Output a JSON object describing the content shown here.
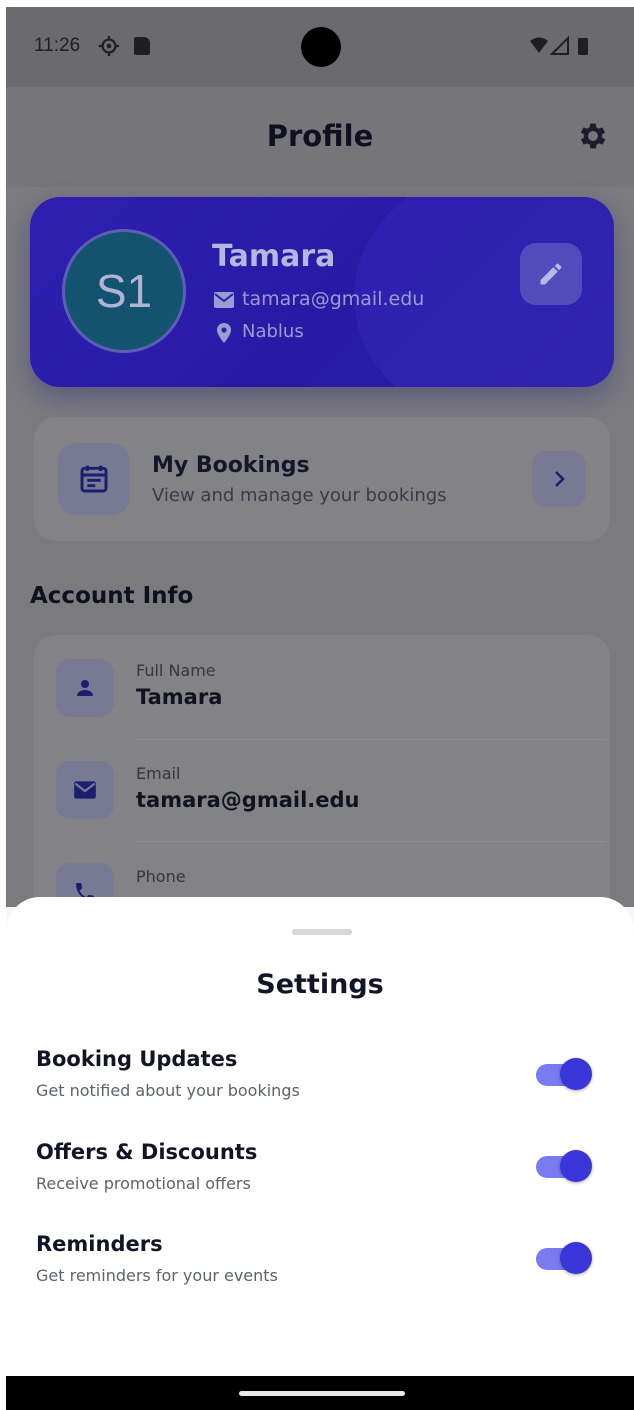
{
  "status_bar": {
    "time": "11:26"
  },
  "header": {
    "title": "Profile"
  },
  "profile": {
    "avatar_initials": "S1",
    "name": "Tamara",
    "email": "tamara@gmail.edu",
    "location": "Nablus"
  },
  "bookings": {
    "title": "My Bookings",
    "subtitle": "View and manage your bookings"
  },
  "account_info": {
    "section_title": "Account Info",
    "fields": [
      {
        "label": "Full Name",
        "value": "Tamara"
      },
      {
        "label": "Email",
        "value": "tamara@gmail.edu"
      },
      {
        "label": "Phone",
        "value": ""
      }
    ]
  },
  "settings_sheet": {
    "title": "Settings",
    "items": [
      {
        "title": "Booking Updates",
        "subtitle": "Get notified about your bookings",
        "enabled": true
      },
      {
        "title": "Offers & Discounts",
        "subtitle": "Receive promotional offers",
        "enabled": true
      },
      {
        "title": "Reminders",
        "subtitle": "Get reminders for your events",
        "enabled": true
      }
    ]
  },
  "colors": {
    "accent": "#3b36d9",
    "toggle_track": "#7a7bf0",
    "profile_card": "#2e1fb0",
    "scrim": "#7a7a7f"
  }
}
